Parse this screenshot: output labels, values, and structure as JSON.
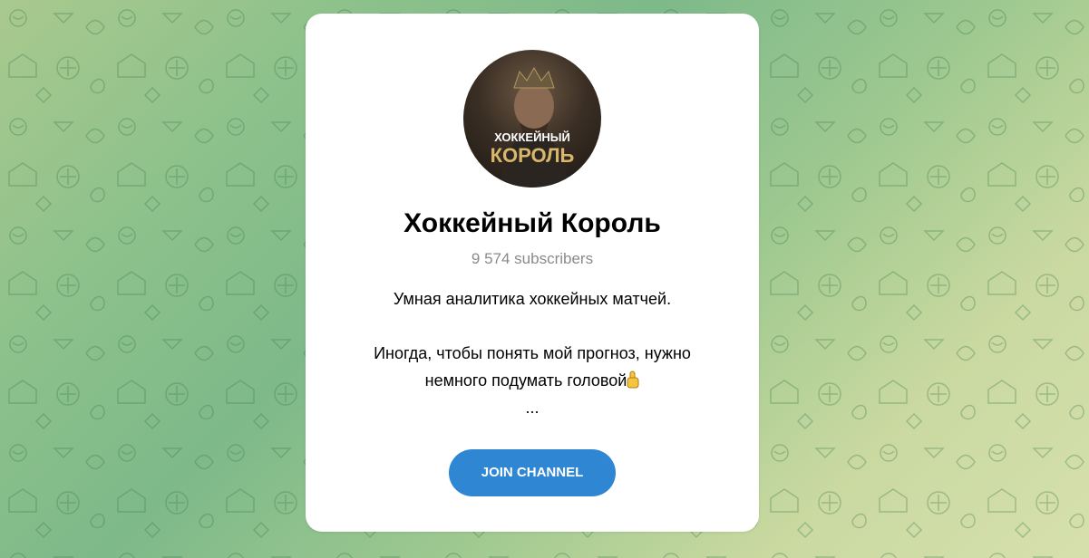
{
  "channel": {
    "avatar_text_line1": "ХОККЕЙНЫЙ",
    "avatar_text_line2": "КОРОЛЬ",
    "title": "Хоккейный Король",
    "subscribers": "9 574 subscribers",
    "description_line1": "Умная аналитика хоккейных матчей.",
    "description_line2": "Иногда, чтобы понять мой прогноз, нужно",
    "description_line3": "немного подумать головой",
    "description_more": "...",
    "emoji_icon": "pointing-up-icon"
  },
  "actions": {
    "join_label": "JOIN CHANNEL"
  },
  "colors": {
    "accent": "#2f86d2",
    "card": "#ffffff",
    "subtitle": "#8a8a8a"
  }
}
